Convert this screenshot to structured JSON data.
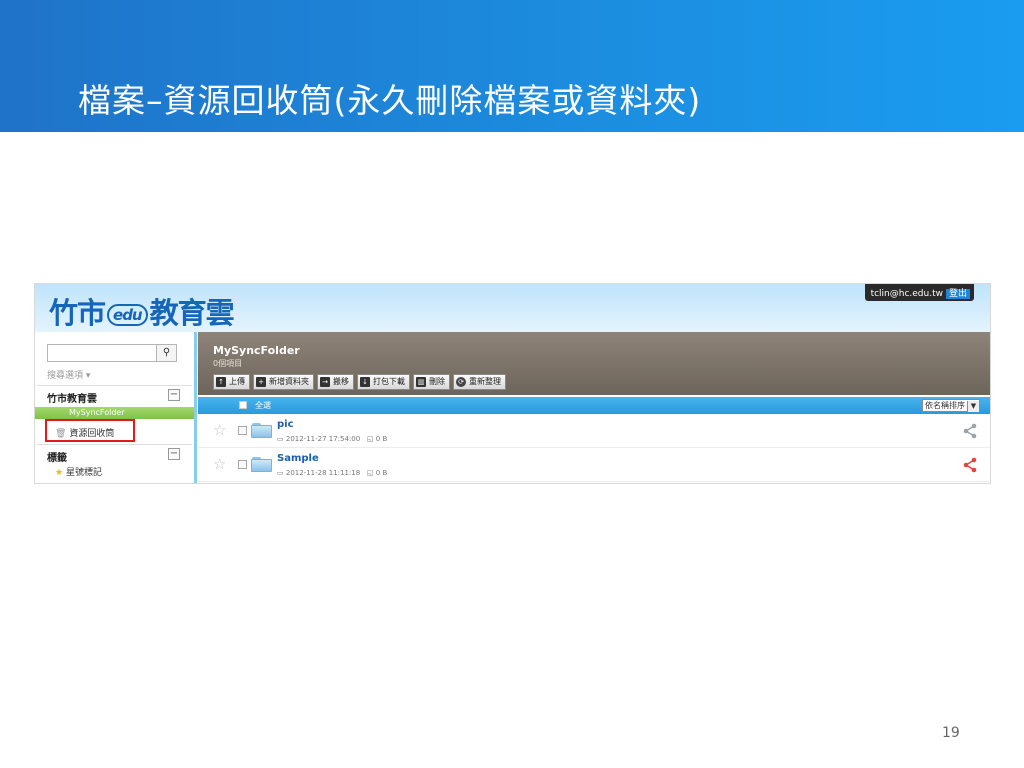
{
  "slide": {
    "title": "檔案–資源回收筒(永久刪除檔案或資料夾)",
    "page_number": "19"
  },
  "app": {
    "logo_text_left": "竹市",
    "logo_mark": "edu",
    "logo_text_right": "教育雲",
    "user_email": "tclin@hc.edu.tw",
    "logout_label": "登出"
  },
  "sidebar": {
    "search_placeholder": "",
    "search_options_label": "搜尋選項 ▾",
    "section_cloud": "竹市教育雲",
    "active_folder": "MySyncFolder",
    "recycle_bin": "資源回收筒",
    "section_tags": "標籤",
    "starred": "星號標記"
  },
  "folder": {
    "name": "MySyncFolder",
    "count": "0個項目",
    "toolbar": {
      "upload": "上傳",
      "new_folder": "新增資料夾",
      "move": "搬移",
      "zip_download": "打包下載",
      "delete": "刪除",
      "refresh": "重新整理"
    },
    "select_all": "全選",
    "sort": "依名稱排序"
  },
  "files": [
    {
      "name": "pic",
      "date": "2012-11-27 17:54:00",
      "size": "0 B",
      "share_color": "#9aa3ab"
    },
    {
      "name": "Sample",
      "date": "2012-11-28 11:11:18",
      "size": "0 B",
      "share_color": "#e0463d"
    }
  ],
  "colors": {
    "header_blue": "#1c8ee0",
    "highlight_red": "#e01b1b",
    "active_green": "#7ec14a"
  }
}
